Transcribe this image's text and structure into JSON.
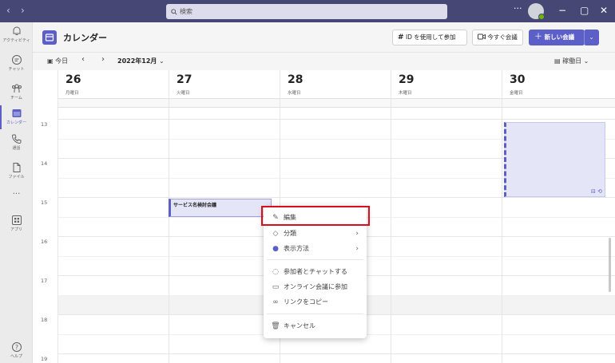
{
  "search": {
    "placeholder": "検索"
  },
  "titlebar": {
    "more": "···",
    "minimize": "−",
    "maximize": "▢",
    "close": "✕"
  },
  "rail": [
    {
      "label": "アクティビティ"
    },
    {
      "label": "チャット"
    },
    {
      "label": "チーム"
    },
    {
      "label": "カレンダー"
    },
    {
      "label": "通話"
    },
    {
      "label": "ファイル"
    },
    {
      "label": "···"
    },
    {
      "label": "アプリ"
    },
    {
      "label": "ヘルプ"
    }
  ],
  "header": {
    "title": "カレンダー",
    "join_id_label": "ID を使用して参加",
    "meet_now_label": "今すぐ会議",
    "new_meeting_label": "新しい会議"
  },
  "toolbar": {
    "today_label": "今日",
    "month_label": "2022年12月",
    "view_label": "稼働日"
  },
  "days": [
    {
      "num": "26",
      "weekday": "月曜日"
    },
    {
      "num": "27",
      "weekday": "火曜日"
    },
    {
      "num": "28",
      "weekday": "水曜日"
    },
    {
      "num": "29",
      "weekday": "木曜日"
    },
    {
      "num": "30",
      "weekday": "金曜日"
    }
  ],
  "hours": [
    "13",
    "14",
    "15",
    "16",
    "17",
    "18",
    "19"
  ],
  "events": [
    {
      "title": "サービス名検討会議"
    }
  ],
  "context_menu": {
    "items": [
      {
        "label": "編集"
      },
      {
        "label": "分類"
      },
      {
        "label": "表示方法"
      },
      {
        "label": "参加者とチャットする"
      },
      {
        "label": "オンライン会議に参加"
      },
      {
        "label": "リンクをコピー"
      },
      {
        "label": "キャンセル"
      }
    ]
  },
  "colors": {
    "accent": "#5b5fc7",
    "titlebar": "#464775",
    "highlight": "#d80d1e"
  }
}
